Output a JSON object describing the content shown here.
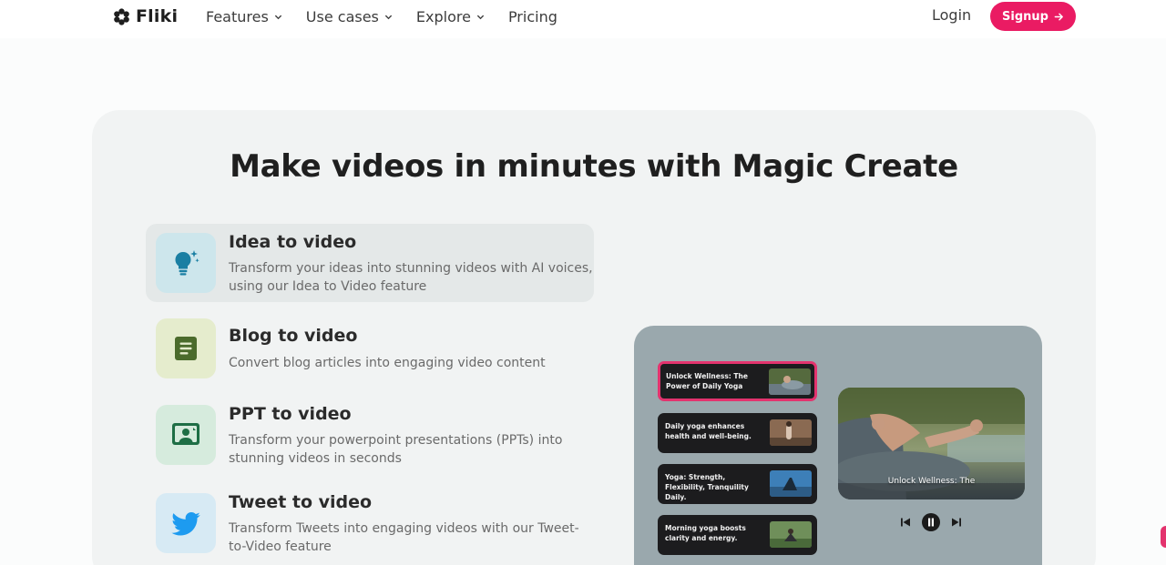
{
  "nav": {
    "logo_text": "Fliki",
    "links": [
      {
        "label": "Features",
        "has_dropdown": true
      },
      {
        "label": "Use cases",
        "has_dropdown": true
      },
      {
        "label": "Explore",
        "has_dropdown": true
      },
      {
        "label": "Pricing",
        "has_dropdown": false
      }
    ],
    "login_label": "Login",
    "signup_label": "Signup"
  },
  "hero": {
    "headline": "Make videos in minutes with Magic Create"
  },
  "features": [
    {
      "title": "Idea to video",
      "description": "Transform your ideas into stunning videos with AI voices, using our Idea to Video feature",
      "icon": "lightbulb-sparkle-icon",
      "active": true
    },
    {
      "title": "Blog to video",
      "description": "Convert blog articles into engaging video content",
      "icon": "document-icon",
      "active": false
    },
    {
      "title": "PPT to video",
      "description": "Transform your powerpoint presentations (PPTs) into stunning videos in seconds",
      "icon": "presentation-icon",
      "active": false
    },
    {
      "title": "Tweet to video",
      "description": "Transform Tweets into engaging videos with our Tweet-to-Video feature",
      "icon": "twitter-bird-icon",
      "active": false
    }
  ],
  "preview": {
    "scenes": [
      {
        "text": "Unlock Wellness: The Power of Daily Yoga",
        "active": true
      },
      {
        "text": "Daily yoga enhances health and well-being.",
        "active": false
      },
      {
        "text": "Yoga: Strength, Flexibility, Tranquility Daily.",
        "active": false
      },
      {
        "text": "Morning yoga boosts clarity and energy.",
        "active": false
      }
    ],
    "video_caption": "Unlock Wellness: The",
    "controls": [
      "previous-icon",
      "pause-icon",
      "next-icon"
    ]
  },
  "colors": {
    "brand_pink": "#ea1b63",
    "active_scene_border": "#e3336e",
    "card_bg": "#f1f3f3",
    "preview_bg": "#9aa8ad",
    "idea_icon_bg": "#cde6ec",
    "blog_icon_bg": "#e5eccd",
    "ppt_icon_bg": "#d6ebdd",
    "tweet_icon_bg": "#d7eaf4"
  }
}
